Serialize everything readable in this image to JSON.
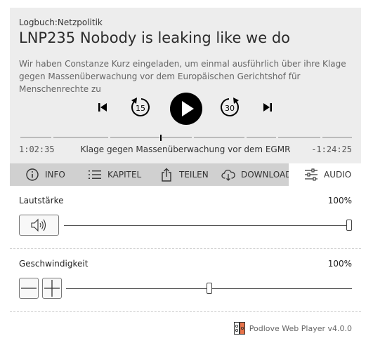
{
  "header": {
    "show": "Logbuch:Netzpolitik",
    "title": "LNP235 Nobody is leaking like we do",
    "description": "Wir haben Constanze Kurz eingeladen, um einmal ausführlich über ihre Klage gegen Massenüberwachung vor dem Europäischen Gerichtshof für Menschenrechte zu"
  },
  "controls": {
    "back_seconds": "15",
    "forward_seconds": "30"
  },
  "playback": {
    "current_time": "1:02:35",
    "chapter": "Klage gegen Massenüberwachung vor dem EGMR",
    "remaining_time": "-1:24:25",
    "progress": 0.43
  },
  "tabs": [
    {
      "label": "INFO",
      "icon": "info-icon"
    },
    {
      "label": "KAPITEL",
      "icon": "list-icon"
    },
    {
      "label": "TEILEN",
      "icon": "share-icon"
    },
    {
      "label": "DOWNLOAD",
      "icon": "cloud-download-icon"
    },
    {
      "label": "AUDIO",
      "icon": "sliders-icon",
      "active": true
    }
  ],
  "audio": {
    "volume_label": "Lautstärke",
    "volume_value": "100%",
    "volume_level": 1.0,
    "speed_label": "Geschwindigkeit",
    "speed_value": "100%",
    "speed_level": 0.5
  },
  "footer": {
    "brand": "Podlove Web Player v4.0.0"
  },
  "colors": {
    "header_bg": "#ededed",
    "tabs_bg": "#d0d0d0",
    "play_button": "#000000",
    "brand_logo": "#e8734a"
  }
}
